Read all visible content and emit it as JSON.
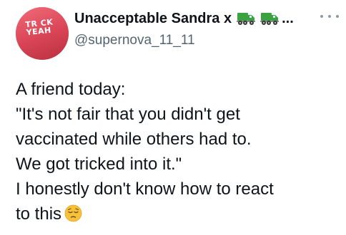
{
  "author": {
    "display_name": "Unacceptable Sandra x",
    "name_emojis": [
      "delivery-truck-icon",
      "delivery-truck-icon"
    ],
    "name_truncation": "...",
    "handle": "@supernova_11_11",
    "avatar_text_line1": "TR CK",
    "avatar_text_line2": "YEAH"
  },
  "tweet": {
    "lines": [
      "A friend today:",
      "\"It's not fair that you didn't get",
      "vaccinated while others had to.",
      "We got tricked into it.\"",
      "I honestly don't know how to react",
      "to this"
    ],
    "trailing_emoji": "pensive-face-icon"
  },
  "colors": {
    "text_primary": "#0f1419",
    "text_secondary": "#536471",
    "truck_green": "#3aa33f",
    "emoji_yellow": "#f7c13a"
  }
}
